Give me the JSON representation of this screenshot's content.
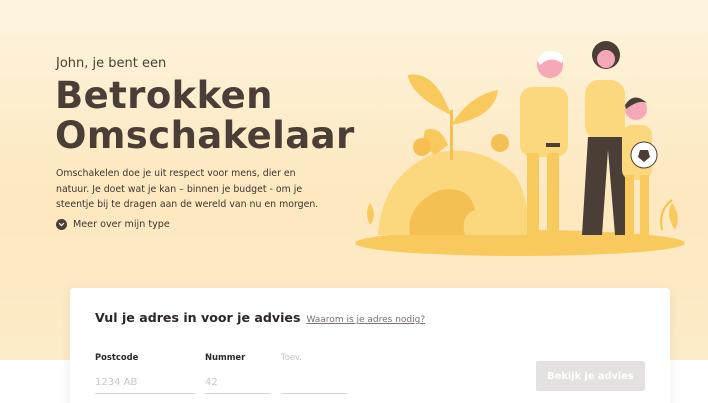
{
  "hero": {
    "intro": "John, je bent een",
    "title": "Betrokken Omschakelaar",
    "description": "Omschakelen doe je uit respect voor mens, dier en natuur. Je doet wat je kan – binnen je budget - om je steentje bij te dragen aan de wereld van nu en morgen.",
    "more_link": "Meer over mijn type"
  },
  "address_form": {
    "title": "Vul je adres in voor je advies",
    "why_link": "Waarom is je adres nodig?",
    "postcode_label": "Postcode",
    "postcode_placeholder": "1234 AB",
    "number_label": "Nummer",
    "number_placeholder": "42",
    "addition_label": "Toev.",
    "submit_label": "Bekijk je advies"
  },
  "colors": {
    "hero_bg": "#fdecc9",
    "title_text": "#4a3e36",
    "illustration_yellow": "#f8c95c",
    "button_disabled": "#e4e1de"
  },
  "icons": {
    "more_link_icon": "chevron-down-icon"
  }
}
